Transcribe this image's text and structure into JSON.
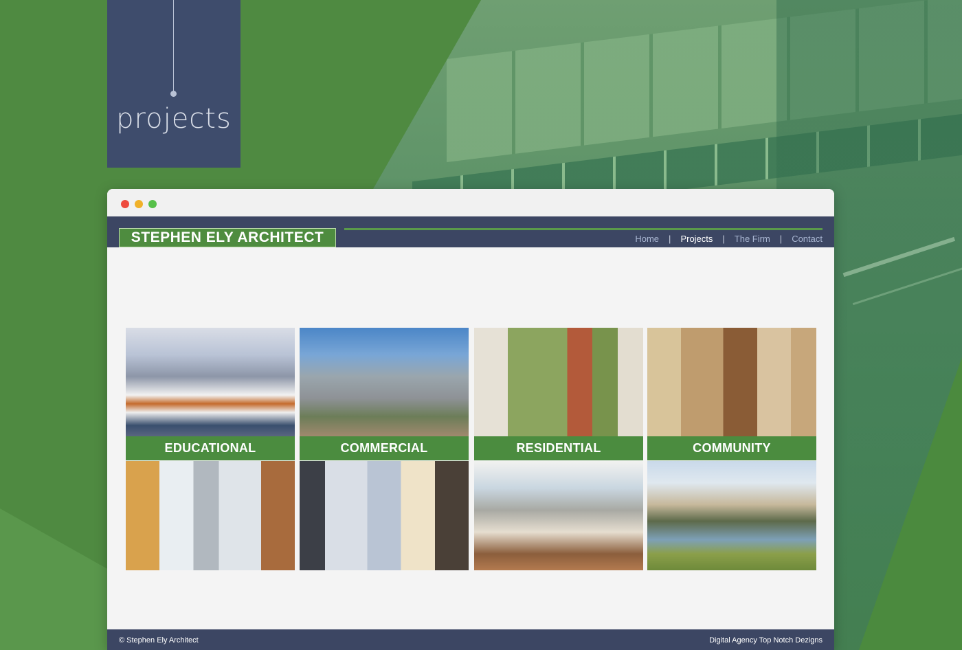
{
  "tag": {
    "label": "projects"
  },
  "site": {
    "logo": "STEPHEN ELY ARCHITECT",
    "nav": [
      {
        "label": "Home",
        "active": false
      },
      {
        "label": "Projects",
        "active": true
      },
      {
        "label": "The Firm",
        "active": false
      },
      {
        "label": "Contact",
        "active": false
      }
    ],
    "separator": "|"
  },
  "categories": [
    {
      "label": "EDUCATIONAL"
    },
    {
      "label": "COMMERCIAL"
    },
    {
      "label": "RESIDENTIAL"
    },
    {
      "label": "COMMUNITY"
    }
  ],
  "footer": {
    "copyright": "© Stephen Ely Architect",
    "credit": "Digital Agency Top Notch Dezigns"
  },
  "colors": {
    "brand_green": "#4b8c3f",
    "header_navy": "#3c4663",
    "tag_navy": "#3e4c6c"
  }
}
